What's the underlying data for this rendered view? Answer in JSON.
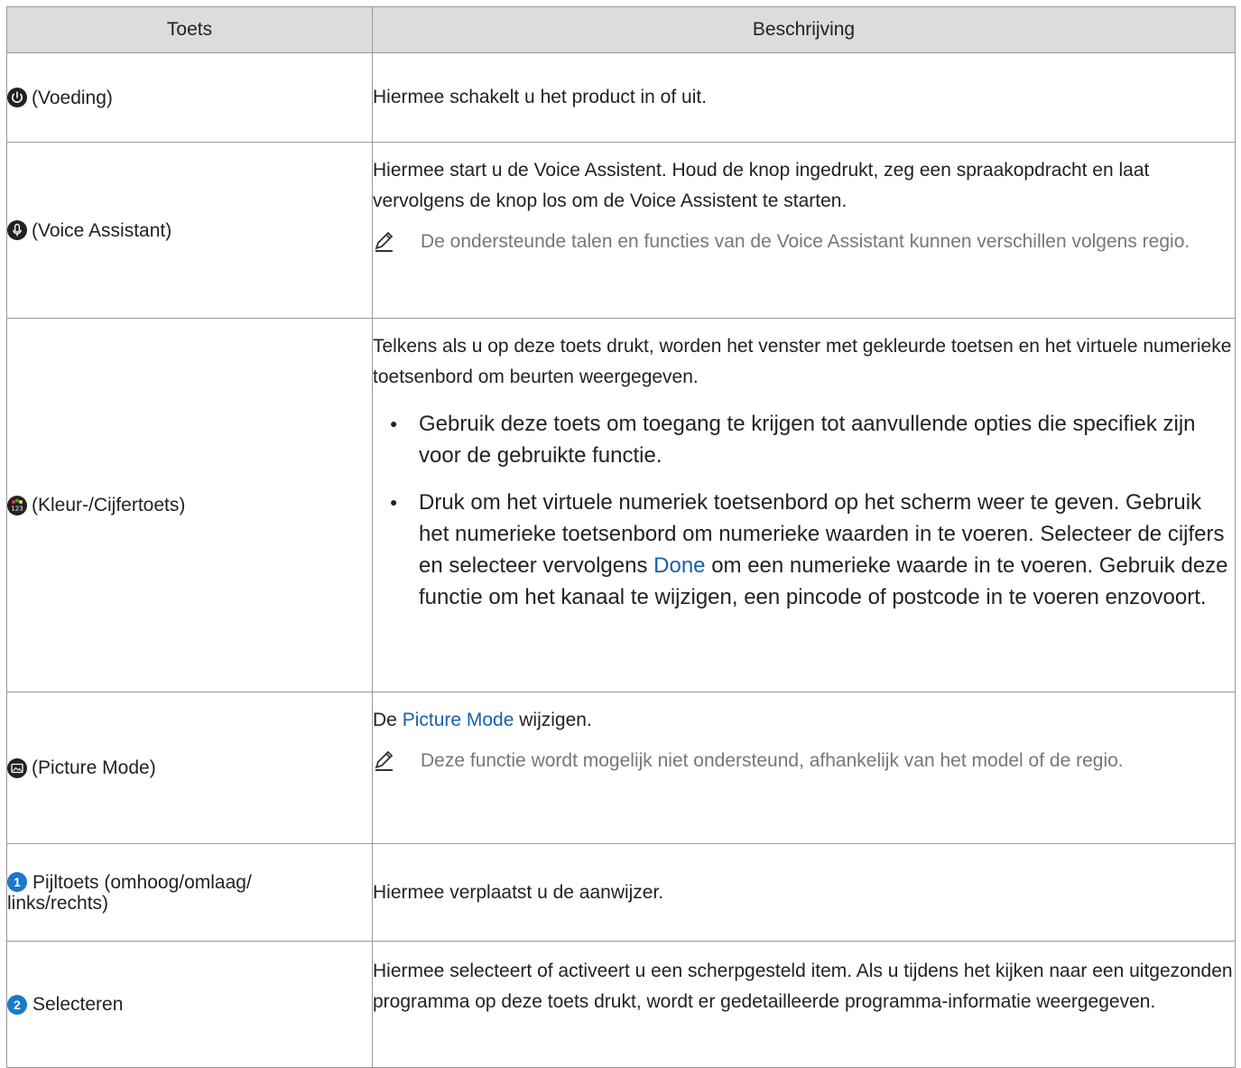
{
  "table": {
    "headers": {
      "key": "Toets",
      "description": "Beschrijving"
    },
    "rows": [
      {
        "icon": "power-icon",
        "key_label": "(Voeding)",
        "description": "Hiermee schakelt u het product in of uit."
      },
      {
        "icon": "microphone-icon",
        "key_label": "(Voice Assistant)",
        "description": "Hiermee start u de Voice Assistent. Houd de knop ingedrukt, zeg een spraakopdracht en laat vervolgens de knop los om de Voice Assistent te starten.",
        "note": "De ondersteunde talen en functies van de Voice Assistant kunnen verschillen volgens regio."
      },
      {
        "icon": "color-number-icon",
        "key_label": "(Kleur-/Cijfertoets)",
        "description": "Telkens als u op deze toets drukt, worden het venster met gekleurde toetsen en het virtuele numerieke toetsenbord om beurten weergegeven.",
        "bullet1": "Gebruik deze toets om toegang te krijgen tot aanvullende opties die specifiek zijn voor de gebruikte functie.",
        "bullet2_part1": "Druk om het virtuele numeriek toetsenbord op het scherm weer te geven. Gebruik het numerieke toetsenbord om numerieke waarden in te voeren. Selecteer de cijfers en selecteer vervolgens ",
        "bullet2_link": "Done",
        "bullet2_part2": " om een numerieke waarde in te voeren. Gebruik deze functie om het kanaal te wijzigen, een pincode of postcode in te voeren enzovoort."
      },
      {
        "icon": "picture-mode-icon",
        "key_label": "(Picture Mode)",
        "description_part1": "De ",
        "description_link": "Picture Mode",
        "description_part2": " wijzigen.",
        "note": "Deze functie wordt mogelijk niet ondersteund, afhankelijk van het model of de regio."
      },
      {
        "number": "1",
        "key_label_line1": "Pijltoets (omhoog/omlaag/",
        "key_label_line2": "links/rechts)",
        "description": "Hiermee verplaatst u de aanwijzer."
      },
      {
        "number": "2",
        "key_label": "Selecteren",
        "description": "Hiermee selecteert of activeert u een scherpgesteld item. Als u tijdens het kijken naar een uitgezonden programma op deze toets drukt, wordt er gedetailleerde programma-informatie weergegeven."
      }
    ]
  },
  "colors": {
    "header_bg": "#dcdcdc",
    "border": "#9a9a9a",
    "link_blue": "#1a5fa8",
    "number_badge": "#1a79c8",
    "note_text": "#777777"
  }
}
